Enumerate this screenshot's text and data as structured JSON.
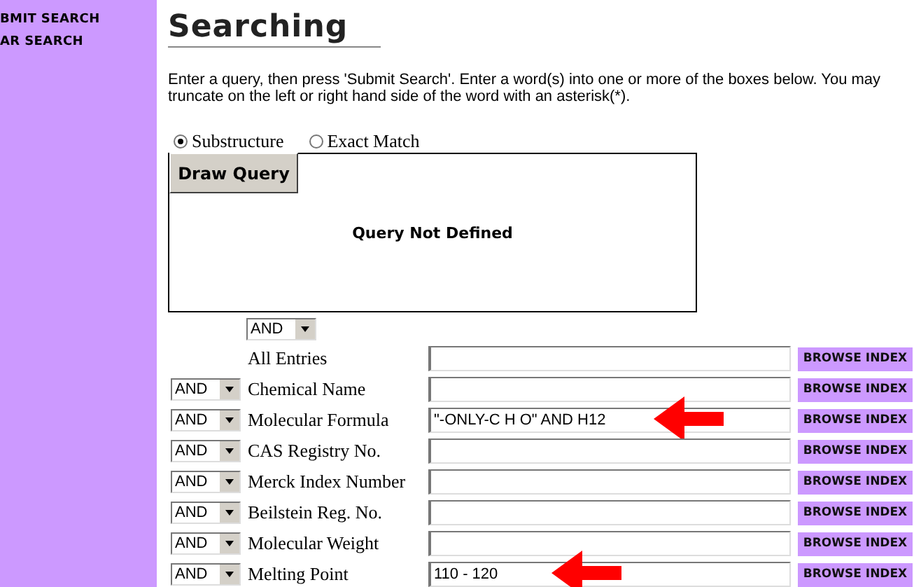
{
  "sidebar": {
    "items": [
      "BMIT SEARCH",
      "AR SEARCH"
    ]
  },
  "title": "Searching",
  "intro": "Enter a query, then press 'Submit Search'. Enter a word(s) into one or more of the boxes below. You may truncate on the left or right hand side of the word with an asterisk(*).",
  "search_type": [
    {
      "label": "Substructure",
      "selected": true
    },
    {
      "label": "Exact Match",
      "selected": false
    }
  ],
  "draw_query_button": "Draw Query",
  "query_status": "Query Not Defined",
  "top_operator": "AND",
  "fields": [
    {
      "label": "All Entries",
      "browse": "BROWSE INDEX",
      "marked": false
    },
    {
      "operator": "AND",
      "label": "Chemical Name",
      "browse": "BROWSE INDEX",
      "marked": false
    },
    {
      "operator": "AND",
      "label": "Molecular Formula",
      "value": "\"-ONLY-C H O\" AND H12",
      "browse": "BROWSE INDEX",
      "marked": true
    },
    {
      "operator": "AND",
      "label": "CAS Registry No.",
      "browse": "BROWSE INDEX",
      "marked": false
    },
    {
      "operator": "AND",
      "label": "Merck Index Number",
      "browse": "BROWSE INDEX",
      "marked": false
    },
    {
      "operator": "AND",
      "label": "Beilstein Reg. No.",
      "browse": "BROWSE INDEX",
      "marked": false
    },
    {
      "operator": "AND",
      "label": "Molecular Weight",
      "browse": "BROWSE INDEX",
      "marked": false
    },
    {
      "operator": "AND",
      "label": "Melting Point",
      "value": "110 - 120",
      "browse": "BROWSE INDEX",
      "marked": true
    }
  ]
}
